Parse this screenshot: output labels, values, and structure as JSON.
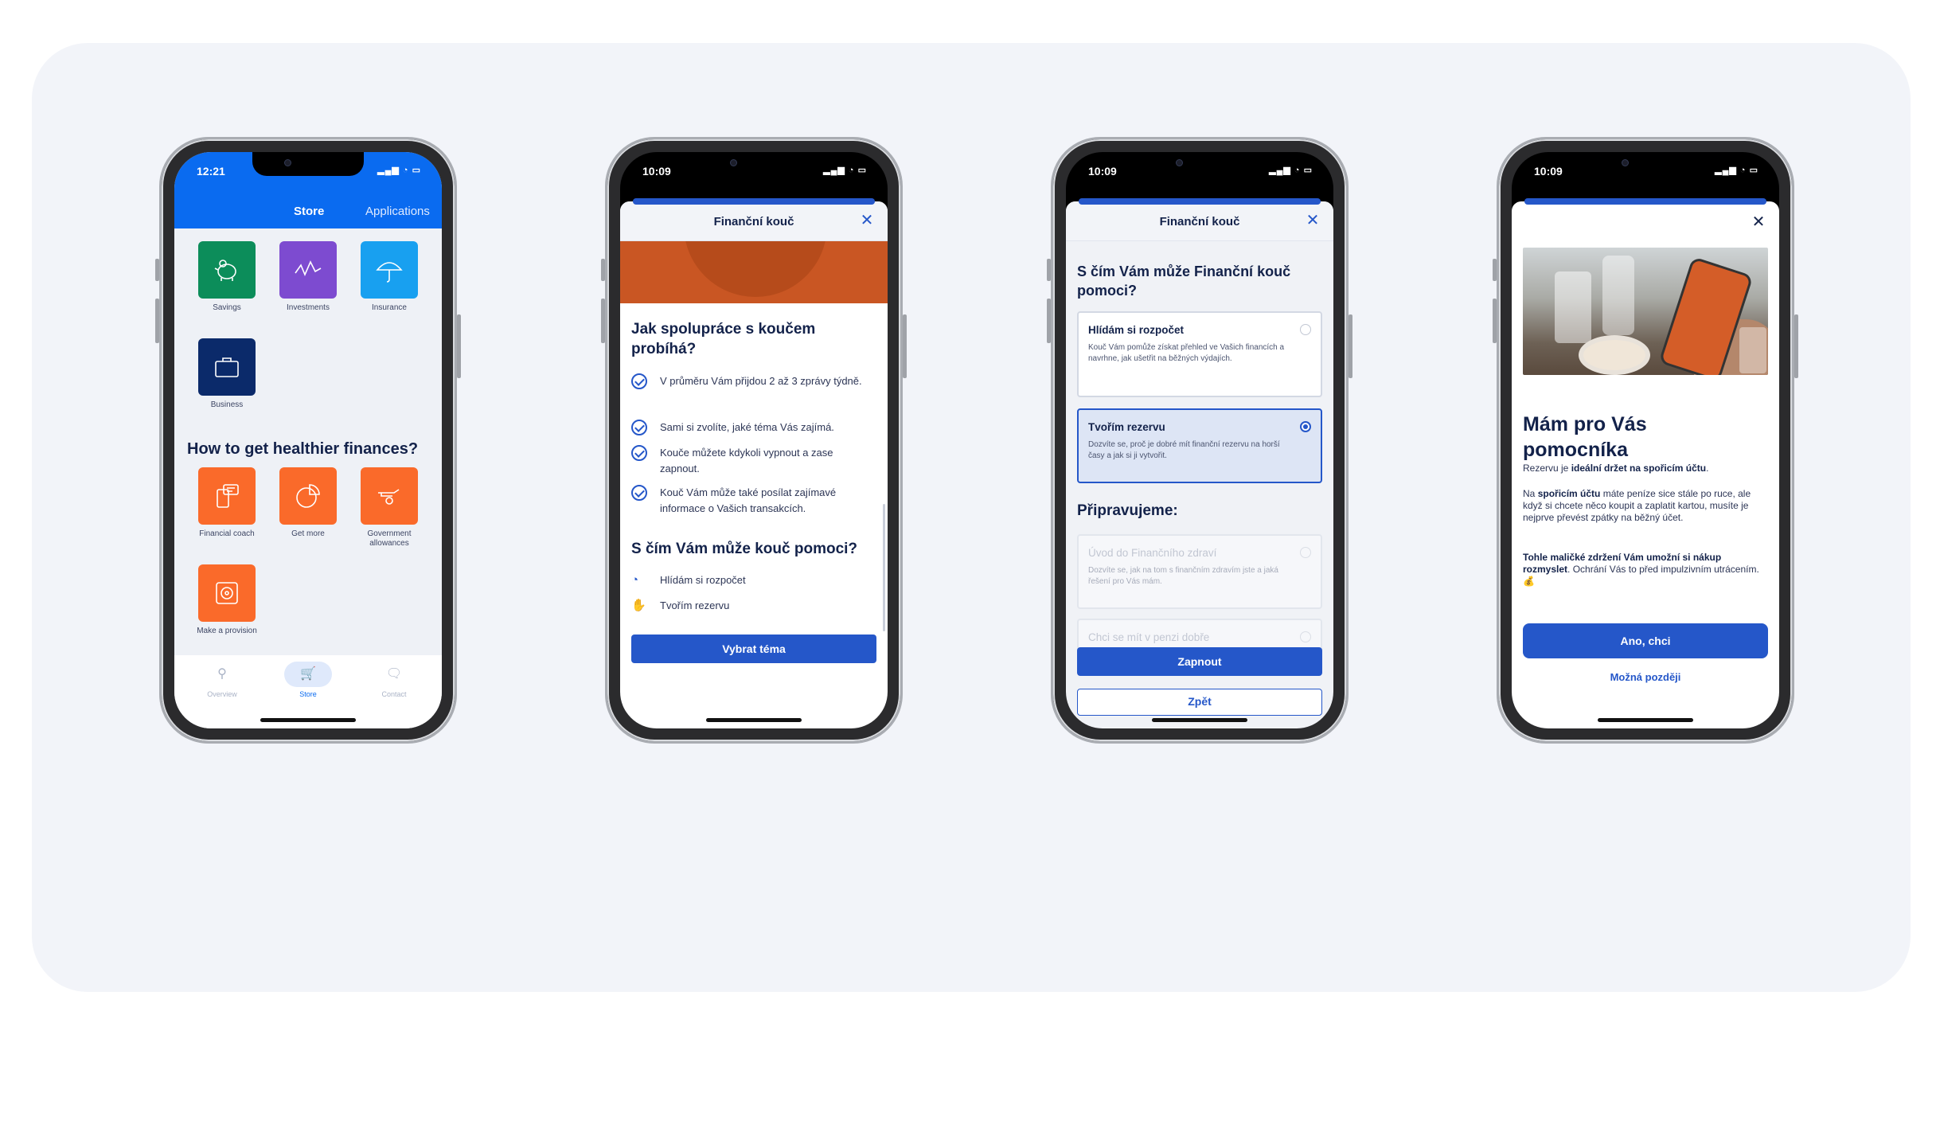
{
  "phone1": {
    "time": "12:21",
    "tabs": {
      "store": "Store",
      "applications": "Applications"
    },
    "tiles": [
      {
        "label": "Savings",
        "icon": "piggy-bank-icon",
        "color": "#0c8d5a"
      },
      {
        "label": "Investments",
        "icon": "chart-line-icon",
        "color": "#7d4bd0"
      },
      {
        "label": "Insurance",
        "icon": "umbrella-icon",
        "color": "#18a0f0"
      },
      {
        "label": "Business",
        "icon": "briefcase-icon",
        "color": "#0b2a6a"
      }
    ],
    "heading": "How to get healthier finances?",
    "services": [
      {
        "label": "Financial coach",
        "icon": "coach-chat-icon",
        "color": "#fa6a2a"
      },
      {
        "label": "Get more",
        "icon": "pie-chart-icon",
        "color": "#fa6a2a"
      },
      {
        "label": "Government allowances",
        "icon": "hand-coin-icon",
        "color": "#fa6a2a"
      },
      {
        "label": "Make a provision",
        "icon": "safe-icon",
        "color": "#fa6a2a"
      }
    ],
    "nav": [
      {
        "label": "Overview",
        "icon": "pin-icon"
      },
      {
        "label": "Store",
        "icon": "cart-icon"
      },
      {
        "label": "Contact",
        "icon": "chat-icon"
      }
    ]
  },
  "phone2": {
    "time": "10:09",
    "title": "Finanční kouč",
    "heading1": "Jak spolupráce s koučem probíhá?",
    "checks": [
      "V průměru Vám přijdou 2 až 3 zprávy týdně.",
      "Sami si zvolíte, jaké téma Vás zajímá.",
      "Kouče můžete kdykoli vypnout a zase zapnout.",
      "Kouč Vám může také posílat zajímavé informace o Vašich transakcích."
    ],
    "heading2": "S čím Vám může kouč pomoci?",
    "topics": [
      {
        "label": "Hlídám si rozpočet",
        "icon": "budget-pie-icon"
      },
      {
        "label": "Tvořím rezervu",
        "icon": "savings-hand-icon"
      }
    ],
    "button": "Vybrat téma"
  },
  "phone3": {
    "time": "10:09",
    "title": "Finanční kouč",
    "heading": "S čím Vám může Finanční kouč pomoci?",
    "options": [
      {
        "title": "Hlídám si rozpočet",
        "desc": "Kouč Vám pomůže získat přehled ve Vašich financích a navrhne, jak ušetřit na běžných výdajích."
      },
      {
        "title": "Tvořím rezervu",
        "desc": "Dozvíte se, proč je dobré mít finanční rezervu na horší časy a jak si ji vytvořit."
      }
    ],
    "coming_heading": "Připravujeme:",
    "coming": [
      {
        "title": "Úvod do Finančního zdraví",
        "desc": "Dozvíte se, jak na tom s finančním zdravím jste a jaká řešení pro Vás mám."
      },
      {
        "title": "Chci se mít v penzi dobře",
        "desc": ""
      }
    ],
    "primary": "Zapnout",
    "secondary": "Zpět"
  },
  "phone4": {
    "time": "10:09",
    "heading": "Mám pro Vás pomocníka",
    "p1_a": "Rezervu je ",
    "p1_b": "ideální držet na spořicím účtu",
    "p1_c": ".",
    "p2_a": "Na ",
    "p2_b": "spořicím účtu",
    "p2_c": " máte peníze sice stále po ruce, ale když si chcete něco koupit a zaplatit kartou, musíte je nejprve převést zpátky na běžný účet.",
    "p3_a": "Tohle maličké zdržení Vám umožní si nákup rozmyslet",
    "p3_b": ". Ochrání Vás to před impulzivním utrácením. 💰",
    "primary": "Ano, chci",
    "secondary": "Možná později"
  },
  "colors": {
    "accent": "#2557c9",
    "store_blue": "#0a6bf0",
    "orange": "#fa6a2a"
  }
}
